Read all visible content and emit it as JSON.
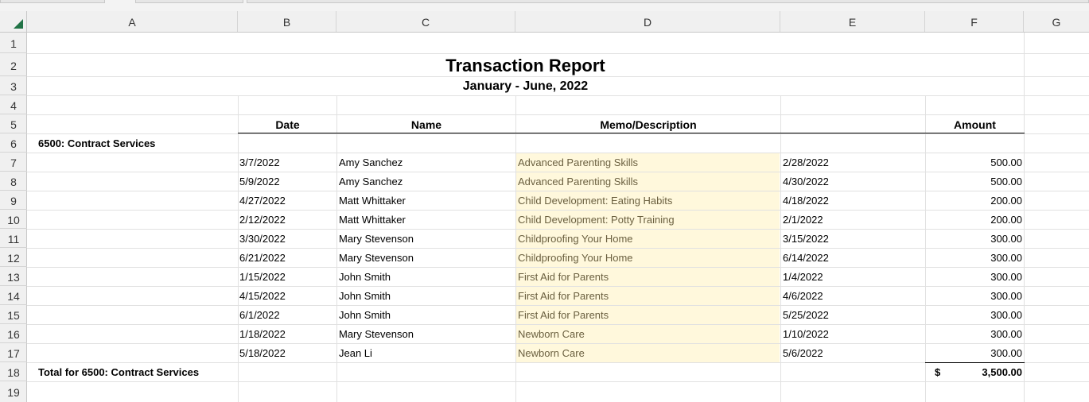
{
  "columns": [
    "A",
    "B",
    "C",
    "D",
    "E",
    "F",
    "G"
  ],
  "rows": [
    "1",
    "2",
    "3",
    "4",
    "5",
    "6",
    "7",
    "8",
    "9",
    "10",
    "11",
    "12",
    "13",
    "14",
    "15",
    "16",
    "17",
    "18",
    "19"
  ],
  "report": {
    "title": "Transaction Report",
    "subtitle": "January - June, 2022"
  },
  "headers": {
    "date": "Date",
    "name": "Name",
    "memo": "Memo/Description",
    "amount": "Amount"
  },
  "group": {
    "label": "6500: Contract Services",
    "total_label": "Total for 6500: Contract Services",
    "total_currency": "$",
    "total_amount": "3,500.00"
  },
  "transactions": [
    {
      "date": "3/7/2022",
      "name": "Amy Sanchez",
      "memo": "Advanced Parenting Skills",
      "e": "2/28/2022",
      "amount": "500.00"
    },
    {
      "date": "5/9/2022",
      "name": "Amy Sanchez",
      "memo": "Advanced Parenting Skills",
      "e": "4/30/2022",
      "amount": "500.00"
    },
    {
      "date": "4/27/2022",
      "name": "Matt Whittaker",
      "memo": "Child Development: Eating Habits",
      "e": "4/18/2022",
      "amount": "200.00"
    },
    {
      "date": "2/12/2022",
      "name": "Matt Whittaker",
      "memo": "Child Development: Potty Training",
      "e": "2/1/2022",
      "amount": "200.00"
    },
    {
      "date": "3/30/2022",
      "name": "Mary Stevenson",
      "memo": "Childproofing Your Home",
      "e": "3/15/2022",
      "amount": "300.00"
    },
    {
      "date": "6/21/2022",
      "name": "Mary Stevenson",
      "memo": "Childproofing Your Home",
      "e": "6/14/2022",
      "amount": "300.00"
    },
    {
      "date": "1/15/2022",
      "name": "John Smith",
      "memo": "First Aid for Parents",
      "e": "1/4/2022",
      "amount": "300.00"
    },
    {
      "date": "4/15/2022",
      "name": "John Smith",
      "memo": "First Aid for Parents",
      "e": "4/6/2022",
      "amount": "300.00"
    },
    {
      "date": "6/1/2022",
      "name": "John Smith",
      "memo": "First Aid for Parents",
      "e": "5/25/2022",
      "amount": "300.00"
    },
    {
      "date": "1/18/2022",
      "name": "Mary Stevenson",
      "memo": "Newborn Care",
      "e": "1/10/2022",
      "amount": "300.00"
    },
    {
      "date": "5/18/2022",
      "name": "Jean Li",
      "memo": "Newborn Care",
      "e": "5/6/2022",
      "amount": "300.00"
    }
  ],
  "colors": {
    "memo_fill": "#fff8dc",
    "memo_text": "#6b6040",
    "excel_green": "#217346"
  }
}
